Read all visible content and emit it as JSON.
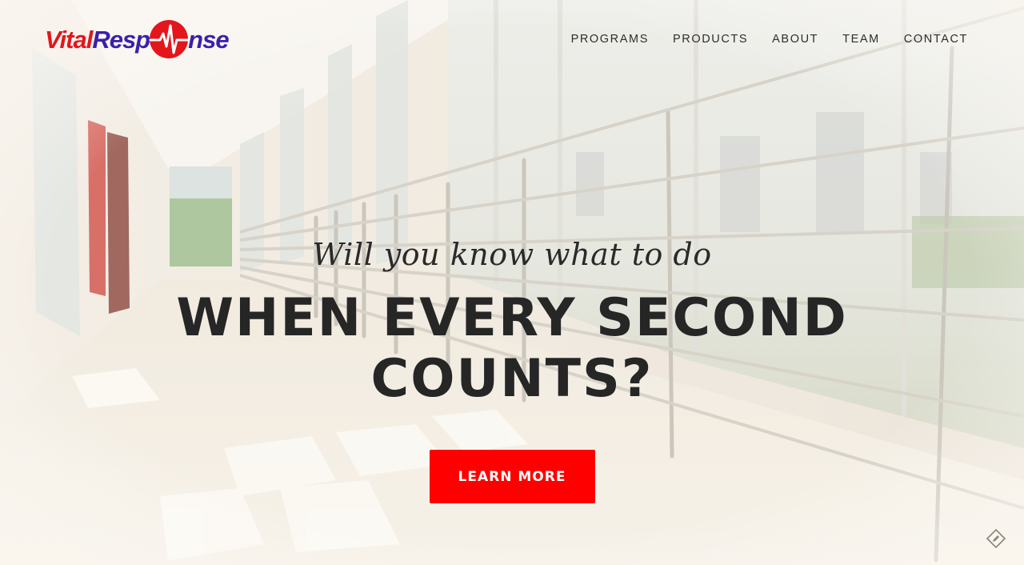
{
  "brand": {
    "logo_part1": "Vital",
    "logo_part2": "Resp",
    "logo_part3": "nse",
    "logo_icon": "heart-ecg-icon",
    "colors": {
      "vital": "#e3161c",
      "response": "#3a21a8",
      "accent": "#fe0000"
    }
  },
  "nav": {
    "items": [
      {
        "label": "PROGRAMS"
      },
      {
        "label": "PRODUCTS"
      },
      {
        "label": "ABOUT"
      },
      {
        "label": "TEAM"
      },
      {
        "label": "CONTACT"
      }
    ]
  },
  "hero": {
    "background": "bright hallway with glass windows and metal railing",
    "tagline": "Will you know what to do",
    "headline": "WHEN EVERY SECOND COUNTS?",
    "cta_label": "LEARN MORE"
  },
  "corner": {
    "icon": "pencil-badge-icon"
  }
}
